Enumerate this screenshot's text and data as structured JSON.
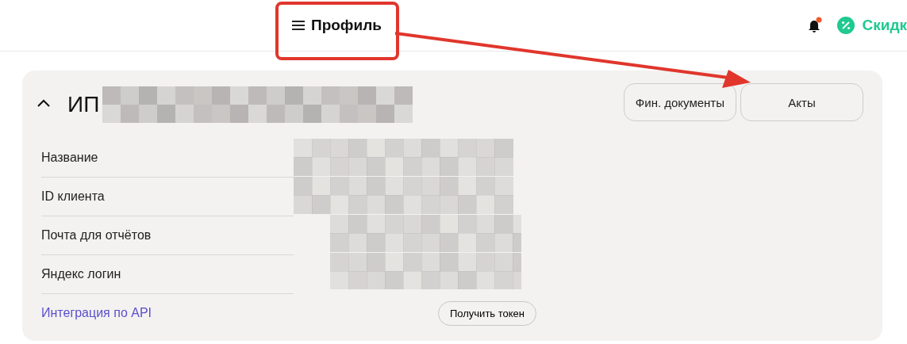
{
  "header": {
    "menu_label": "Профиль",
    "discount_label": "Скидк",
    "notification_dot": true
  },
  "annotation": {
    "highlight": true,
    "arrow": true
  },
  "card": {
    "expanded": true,
    "title": "ИП",
    "buttons": [
      {
        "label": "Фин. документы"
      },
      {
        "label": "Акты"
      }
    ],
    "rows": [
      {
        "kind": "field",
        "label": "Название"
      },
      {
        "kind": "field",
        "label": "ID клиента"
      },
      {
        "kind": "field",
        "label": "Почта для отчётов"
      },
      {
        "kind": "field",
        "label": "Яндекс логин"
      },
      {
        "kind": "link",
        "label": "Интеграция по API",
        "action": "Получить токен"
      }
    ]
  }
}
